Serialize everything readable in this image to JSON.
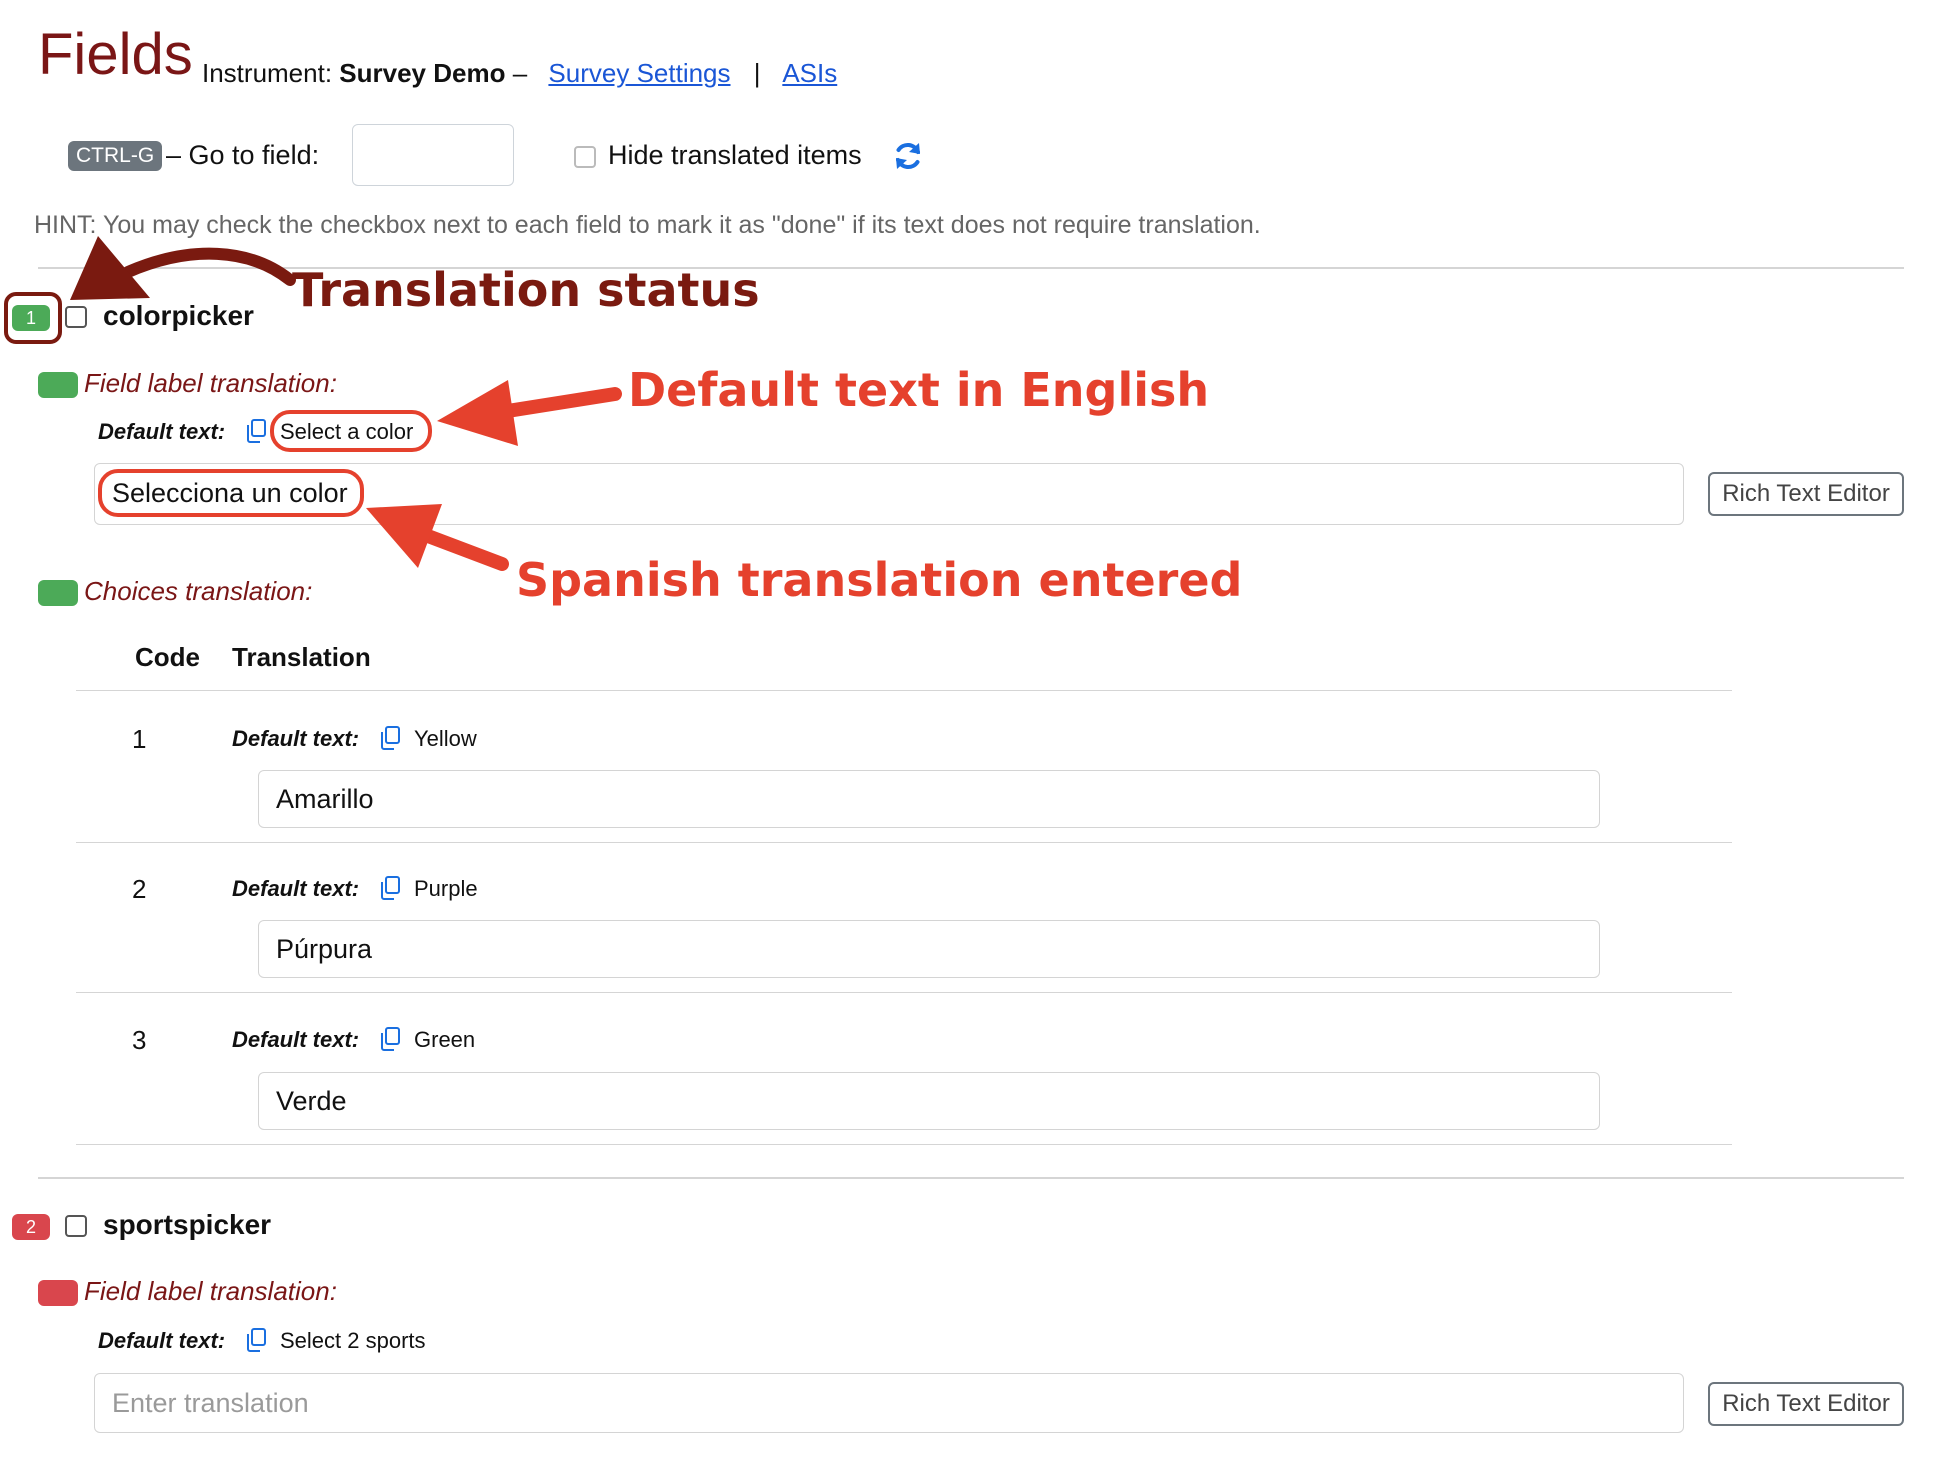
{
  "header": {
    "title": "Fields",
    "instrument_label": "Instrument:",
    "instrument_name": "Survey Demo",
    "dash": "–",
    "survey_settings_link": "Survey Settings",
    "separator": "|",
    "asis_link": "ASIs"
  },
  "toolbar": {
    "shortcut": "CTRL-G",
    "goto_label": "– Go to field:",
    "goto_value": "",
    "hide_translated_label": "Hide translated items",
    "hide_translated_checked": false
  },
  "hint": "HINT: You may check the checkbox next to each field to mark it as \"done\" if its text does not require translation.",
  "fields": [
    {
      "number": "1",
      "status": "translated",
      "status_color": "#4caa58",
      "checked": false,
      "name": "colorpicker",
      "label_section": "Field label translation:",
      "default_label": "Default text:",
      "default_text": "Select a color",
      "translation_value": "Selecciona un color",
      "rich_text_button": "Rich Text Editor",
      "choices_section": "Choices translation:",
      "choices_headers": {
        "code": "Code",
        "translation": "Translation"
      },
      "choices": [
        {
          "code": "1",
          "default_label": "Default text:",
          "default_text": "Yellow",
          "translation": "Amarillo"
        },
        {
          "code": "2",
          "default_label": "Default text:",
          "default_text": "Purple",
          "translation": "Púrpura"
        },
        {
          "code": "3",
          "default_label": "Default text:",
          "default_text": "Green",
          "translation": "Verde"
        }
      ]
    },
    {
      "number": "2",
      "status": "untranslated",
      "status_color": "#d9464d",
      "checked": false,
      "name": "sportspicker",
      "label_section": "Field label translation:",
      "default_label": "Default text:",
      "default_text": "Select 2 sports",
      "translation_placeholder": "Enter translation",
      "rich_text_button": "Rich Text Editor"
    }
  ],
  "annotations": {
    "translation_status": "Translation status",
    "default_text_english": "Default text in English",
    "spanish_entered": "Spanish translation entered",
    "callout_color": "#e5412d",
    "status_callout_color": "#7a1a10"
  },
  "icons": {
    "refresh": "refresh-icon",
    "copy": "copy-icon"
  }
}
